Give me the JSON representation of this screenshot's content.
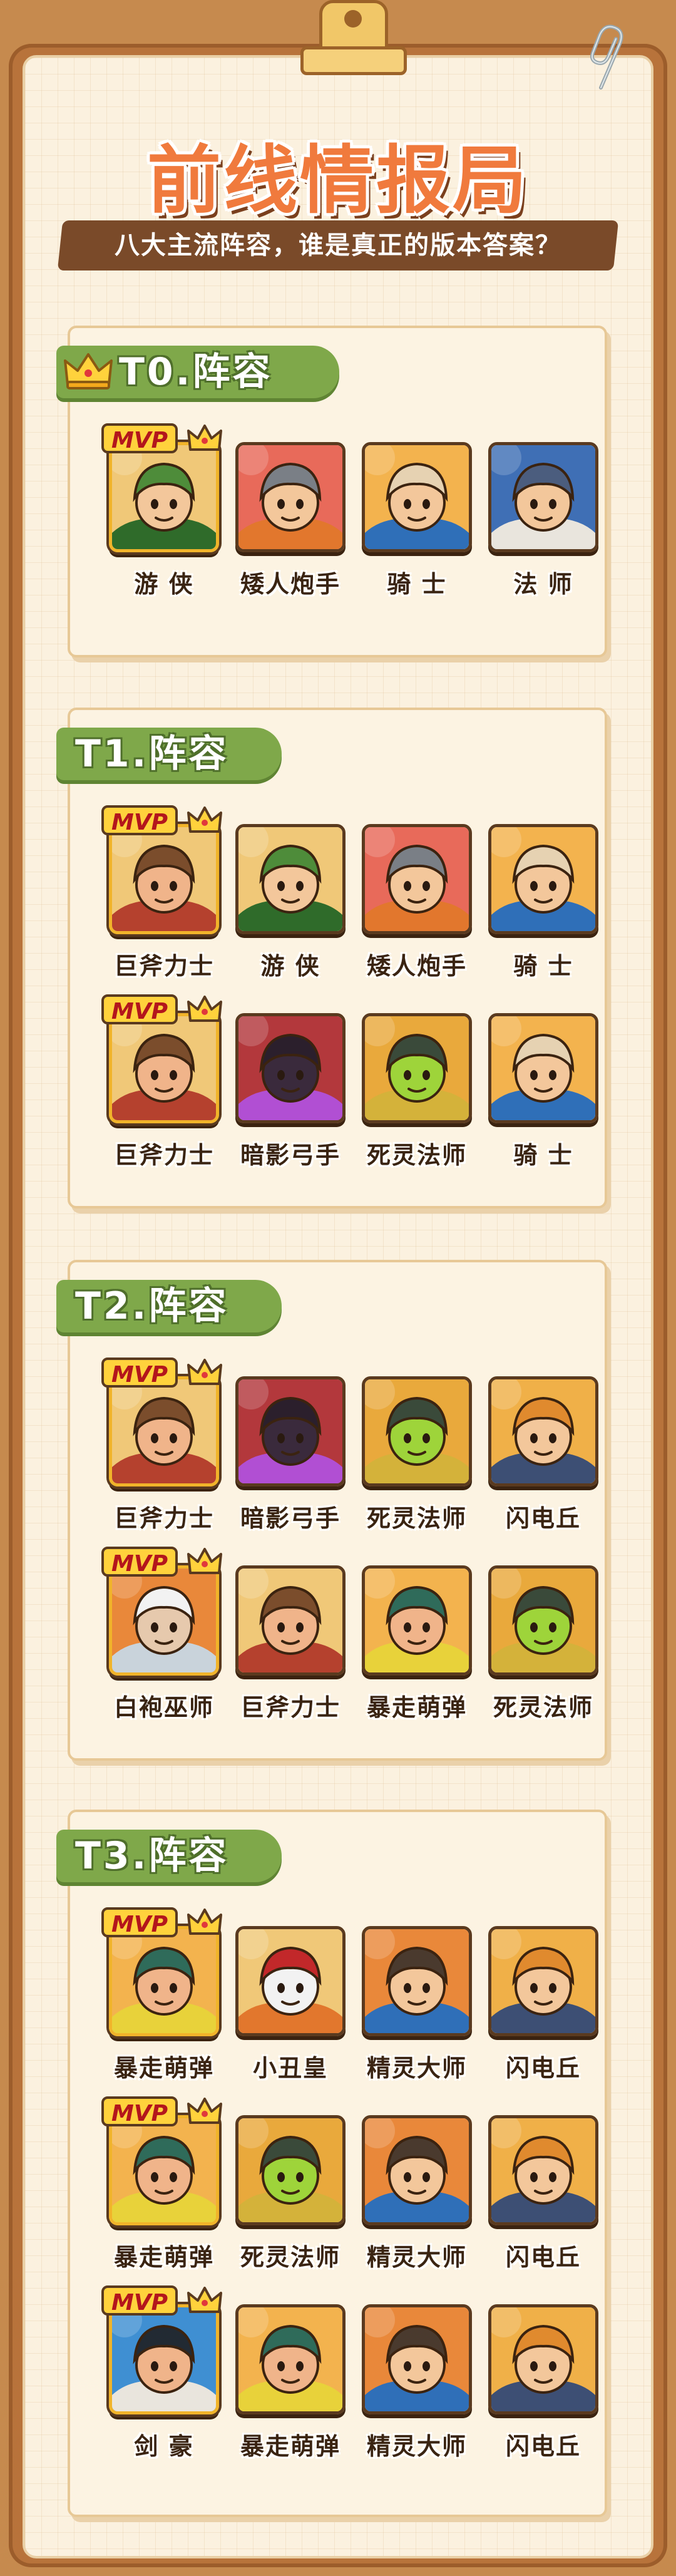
{
  "title": "前线情报局",
  "subtitle": "八大主流阵容，谁是真正的版本答案？",
  "mvp_label": "MVP",
  "colors": {
    "title": "#f07a3d",
    "tier_tab": "#7fa84a",
    "mvp_border": "#f1b42a",
    "text": "#3a2412",
    "board": "#b8733b"
  },
  "tiers": [
    {
      "label": "T0.阵容",
      "has_crown_icon": true,
      "rows": [
        [
          {
            "name": "游 侠",
            "mvp": true,
            "icon": "ranger-portrait"
          },
          {
            "name": "矮人炮手",
            "mvp": false,
            "icon": "dwarf-gunner-portrait"
          },
          {
            "name": "骑 士",
            "mvp": false,
            "icon": "knight-portrait"
          },
          {
            "name": "法 师",
            "mvp": false,
            "icon": "mage-portrait"
          }
        ]
      ]
    },
    {
      "label": "T1.阵容",
      "has_crown_icon": false,
      "rows": [
        [
          {
            "name": "巨斧力士",
            "mvp": true,
            "icon": "axe-warrior-portrait"
          },
          {
            "name": "游 侠",
            "mvp": false,
            "icon": "ranger-portrait"
          },
          {
            "name": "矮人炮手",
            "mvp": false,
            "icon": "dwarf-gunner-portrait"
          },
          {
            "name": "骑 士",
            "mvp": false,
            "icon": "knight-portrait"
          }
        ],
        [
          {
            "name": "巨斧力士",
            "mvp": true,
            "icon": "axe-warrior-portrait"
          },
          {
            "name": "暗影弓手",
            "mvp": false,
            "icon": "shadow-archer-portrait"
          },
          {
            "name": "死灵法师",
            "mvp": false,
            "icon": "necromancer-portrait"
          },
          {
            "name": "骑 士",
            "mvp": false,
            "icon": "knight-portrait"
          }
        ]
      ]
    },
    {
      "label": "T2.阵容",
      "has_crown_icon": false,
      "rows": [
        [
          {
            "name": "巨斧力士",
            "mvp": true,
            "icon": "axe-warrior-portrait"
          },
          {
            "name": "暗影弓手",
            "mvp": false,
            "icon": "shadow-archer-portrait"
          },
          {
            "name": "死灵法师",
            "mvp": false,
            "icon": "necromancer-portrait"
          },
          {
            "name": "闪电丘",
            "mvp": false,
            "icon": "lightning-qiu-portrait"
          }
        ],
        [
          {
            "name": "白袍巫师",
            "mvp": true,
            "icon": "white-wizard-portrait"
          },
          {
            "name": "巨斧力士",
            "mvp": false,
            "icon": "axe-warrior-portrait"
          },
          {
            "name": "暴走萌弹",
            "mvp": false,
            "icon": "rampage-bomber-portrait"
          },
          {
            "name": "死灵法师",
            "mvp": false,
            "icon": "necromancer-portrait"
          }
        ]
      ]
    },
    {
      "label": "T3.阵容",
      "has_crown_icon": false,
      "rows": [
        [
          {
            "name": "暴走萌弹",
            "mvp": true,
            "icon": "rampage-bomber-portrait"
          },
          {
            "name": "小丑皇",
            "mvp": false,
            "icon": "clown-king-portrait"
          },
          {
            "name": "精灵大师",
            "mvp": false,
            "icon": "elf-master-portrait"
          },
          {
            "name": "闪电丘",
            "mvp": false,
            "icon": "lightning-qiu-portrait"
          }
        ],
        [
          {
            "name": "暴走萌弹",
            "mvp": true,
            "icon": "rampage-bomber-portrait"
          },
          {
            "name": "死灵法师",
            "mvp": false,
            "icon": "necromancer-portrait"
          },
          {
            "name": "精灵大师",
            "mvp": false,
            "icon": "elf-master-portrait"
          },
          {
            "name": "闪电丘",
            "mvp": false,
            "icon": "lightning-qiu-portrait"
          }
        ],
        [
          {
            "name": "剑 豪",
            "mvp": true,
            "icon": "swordmaster-portrait"
          },
          {
            "name": "暴走萌弹",
            "mvp": false,
            "icon": "rampage-bomber-portrait"
          },
          {
            "name": "精灵大师",
            "mvp": false,
            "icon": "elf-master-portrait"
          },
          {
            "name": "闪电丘",
            "mvp": false,
            "icon": "lightning-qiu-portrait"
          }
        ]
      ]
    }
  ]
}
